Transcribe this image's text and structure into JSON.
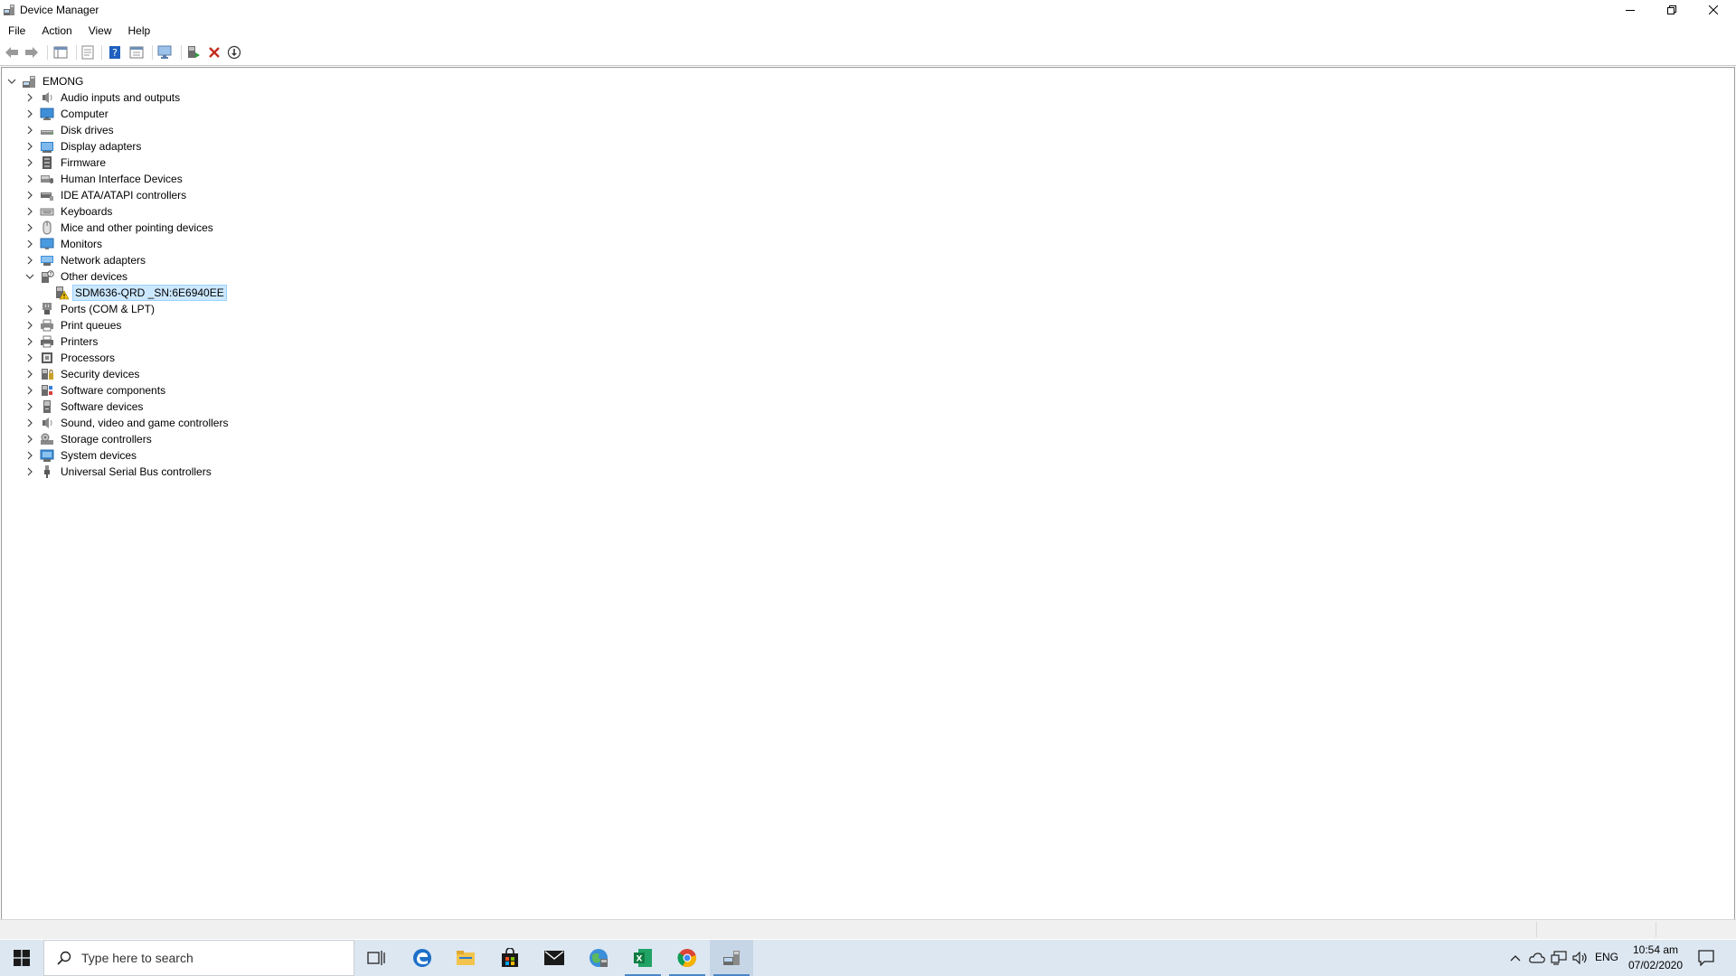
{
  "window": {
    "title": "Device Manager"
  },
  "menu": [
    {
      "id": "file",
      "label": "File"
    },
    {
      "id": "action",
      "label": "Action"
    },
    {
      "id": "view",
      "label": "View"
    },
    {
      "id": "help",
      "label": "Help"
    }
  ],
  "toolbar": {
    "icons": [
      "back-arrow-icon",
      "forward-arrow-icon",
      "show-hide-console-tree-icon",
      "properties-icon",
      "help-icon",
      "device-view-icon",
      "scan-hardware-changes-icon",
      "update-driver-icon",
      "uninstall-device-icon",
      "download-driver-icon"
    ]
  },
  "tree": {
    "root": {
      "label": "EMONG",
      "expanded": true
    },
    "items": [
      {
        "label": "Audio inputs and outputs",
        "icon": "speaker-icon",
        "expanded": false,
        "level": 1
      },
      {
        "label": "Computer",
        "icon": "computer-icon",
        "expanded": false,
        "level": 1
      },
      {
        "label": "Disk drives",
        "icon": "disk-drive-icon",
        "expanded": false,
        "level": 1
      },
      {
        "label": "Display adapters",
        "icon": "display-adapter-icon",
        "expanded": false,
        "level": 1
      },
      {
        "label": "Firmware",
        "icon": "firmware-icon",
        "expanded": false,
        "level": 1
      },
      {
        "label": "Human Interface Devices",
        "icon": "hid-icon",
        "expanded": false,
        "level": 1
      },
      {
        "label": "IDE ATA/ATAPI controllers",
        "icon": "ide-controller-icon",
        "expanded": false,
        "level": 1
      },
      {
        "label": "Keyboards",
        "icon": "keyboard-icon",
        "expanded": false,
        "level": 1
      },
      {
        "label": "Mice and other pointing devices",
        "icon": "mouse-icon",
        "expanded": false,
        "level": 1
      },
      {
        "label": "Monitors",
        "icon": "monitor-icon",
        "expanded": false,
        "level": 1
      },
      {
        "label": "Network adapters",
        "icon": "network-adapter-icon",
        "expanded": false,
        "level": 1
      },
      {
        "label": "Other devices",
        "icon": "other-devices-icon",
        "expanded": true,
        "level": 1
      },
      {
        "label": "SDM636-QRD _SN:6E6940EE",
        "icon": "warning-device-icon",
        "selected": true,
        "level": 2
      },
      {
        "label": "Ports (COM & LPT)",
        "icon": "port-icon",
        "expanded": false,
        "level": 1
      },
      {
        "label": "Print queues",
        "icon": "print-queue-icon",
        "expanded": false,
        "level": 1
      },
      {
        "label": "Printers",
        "icon": "printer-icon",
        "expanded": false,
        "level": 1
      },
      {
        "label": "Processors",
        "icon": "processor-icon",
        "expanded": false,
        "level": 1
      },
      {
        "label": "Security devices",
        "icon": "security-device-icon",
        "expanded": false,
        "level": 1
      },
      {
        "label": "Software components",
        "icon": "software-component-icon",
        "expanded": false,
        "level": 1
      },
      {
        "label": "Software devices",
        "icon": "software-device-icon",
        "expanded": false,
        "level": 1
      },
      {
        "label": "Sound, video and game controllers",
        "icon": "sound-controller-icon",
        "expanded": false,
        "level": 1
      },
      {
        "label": "Storage controllers",
        "icon": "storage-controller-icon",
        "expanded": false,
        "level": 1
      },
      {
        "label": "System devices",
        "icon": "system-device-icon",
        "expanded": false,
        "level": 1
      },
      {
        "label": "Universal Serial Bus controllers",
        "icon": "usb-icon",
        "expanded": false,
        "level": 1
      }
    ]
  },
  "taskbar": {
    "search_placeholder": "Type here to search",
    "apps": [
      "task-view-icon",
      "edge-icon",
      "file-explorer-icon",
      "store-icon",
      "mail-icon",
      "network-globe-icon",
      "excel-icon",
      "chrome-icon",
      "device-manager-taskbar-icon"
    ],
    "language": "ENG",
    "time": "10:54 am",
    "date": "07/02/2020"
  },
  "colors": {
    "selection": "#cce8ff",
    "taskbar": "#dde7f1",
    "accent": "#4a86c8"
  }
}
